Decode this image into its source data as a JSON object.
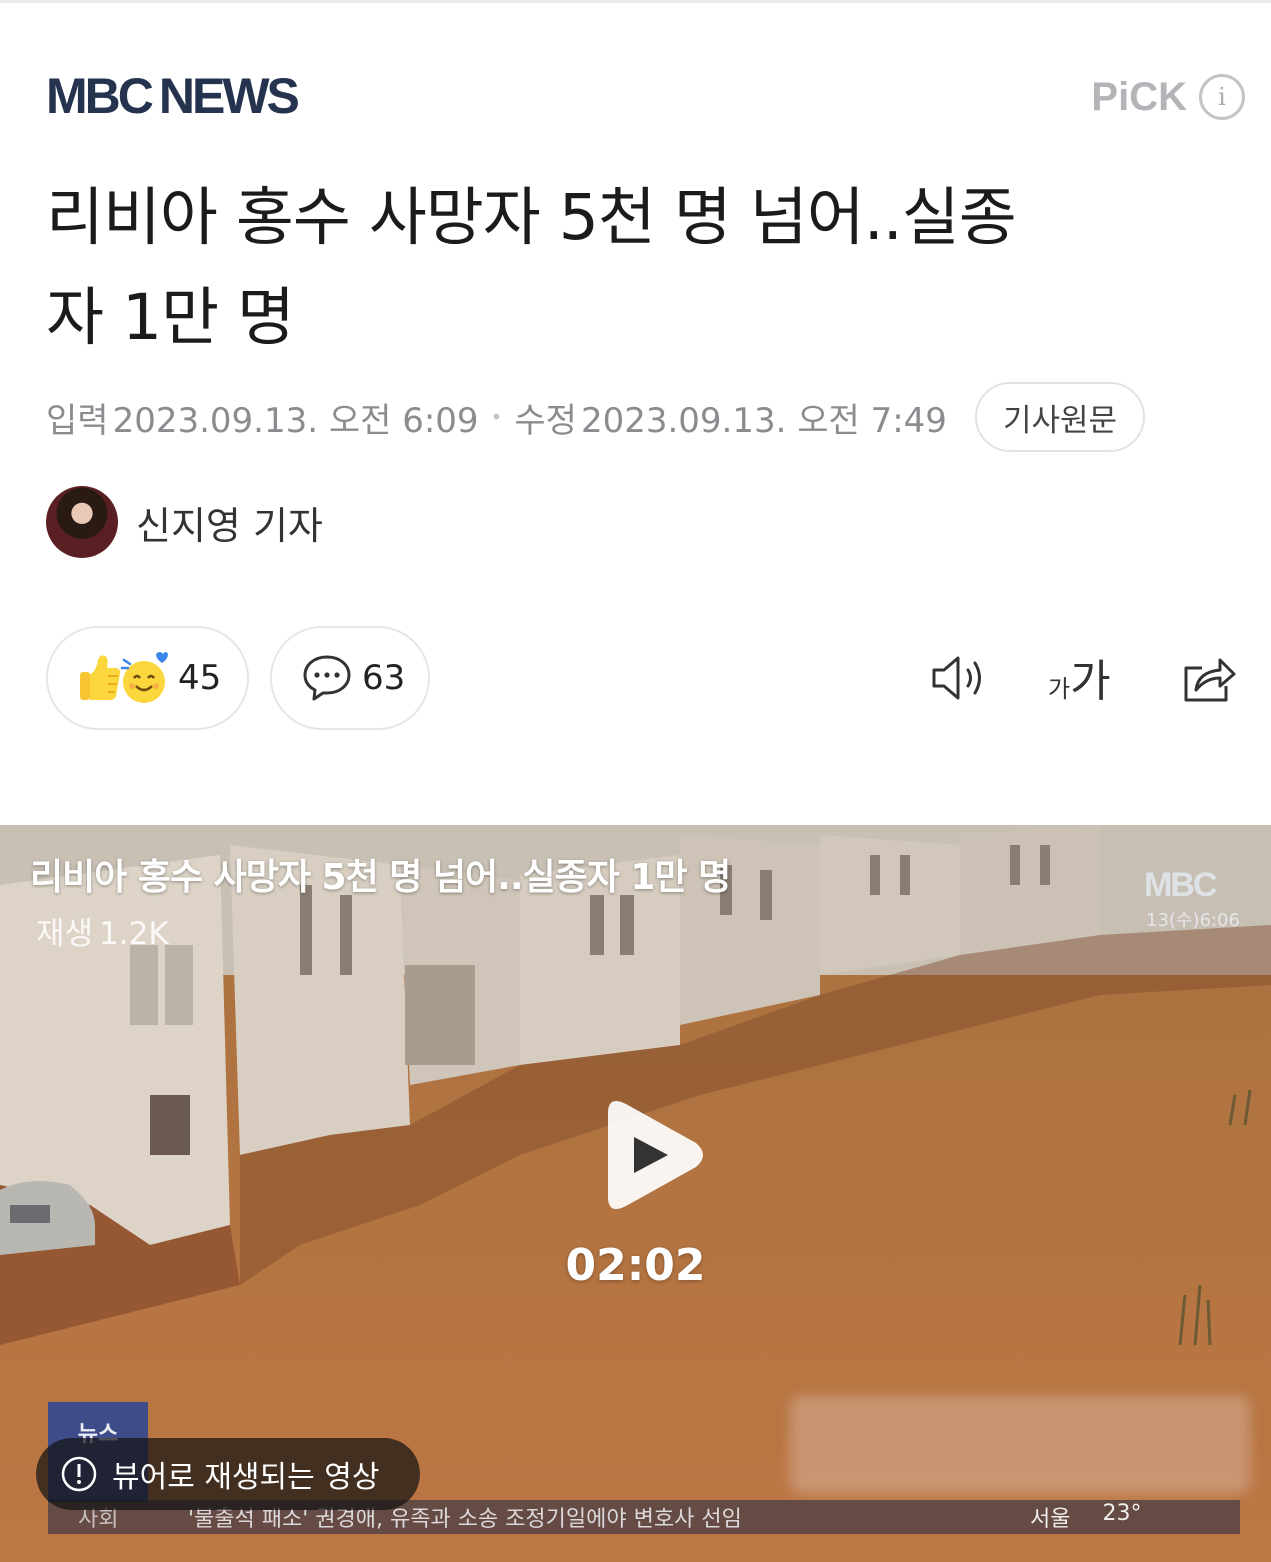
{
  "header": {
    "logo_mbc": "MBC",
    "logo_news": "NEWS",
    "pick_label": "PiCK",
    "pick_info": "i"
  },
  "article": {
    "title_line1": "리비아 홍수 사망자 5천 명 넘어..실종",
    "title_line2": "자 1만 명",
    "input_label": "입력",
    "input_time": "2023.09.13. 오전 6:09",
    "edit_label": "수정",
    "edit_time": "2023.09.13. 오전 7:49",
    "original_button": "기사원문",
    "reporter": "신지영 기자"
  },
  "actions": {
    "reaction_count": "45",
    "comment_count": "63",
    "font_size_label_small": "가",
    "font_size_label_large": "가"
  },
  "video": {
    "title": "리비아 홍수 사망자 5천 명 넘어..실종자 1만 명",
    "views_label": "재생",
    "views_count": "1.2K",
    "duration": "02:02",
    "watermark": "MBC",
    "watermark_time": "13(수)6:06",
    "toast": "뷰어로 재생되는 영상",
    "badge": "뉴스",
    "ticker_category": "사회",
    "ticker_text": "'불출석 패소' 권경애, 유족과 소송 조정기일에야 변호사 선임",
    "ticker_city": "서울",
    "ticker_temp": "23°"
  },
  "colors": {
    "logo": "#25334f",
    "muted": "#8b8b90",
    "flood": "#b4703e"
  },
  "icons": [
    "thumbs-up-icon",
    "smile-icon",
    "comment-icon",
    "speaker-icon",
    "share-icon",
    "play-icon",
    "info-icon"
  ]
}
